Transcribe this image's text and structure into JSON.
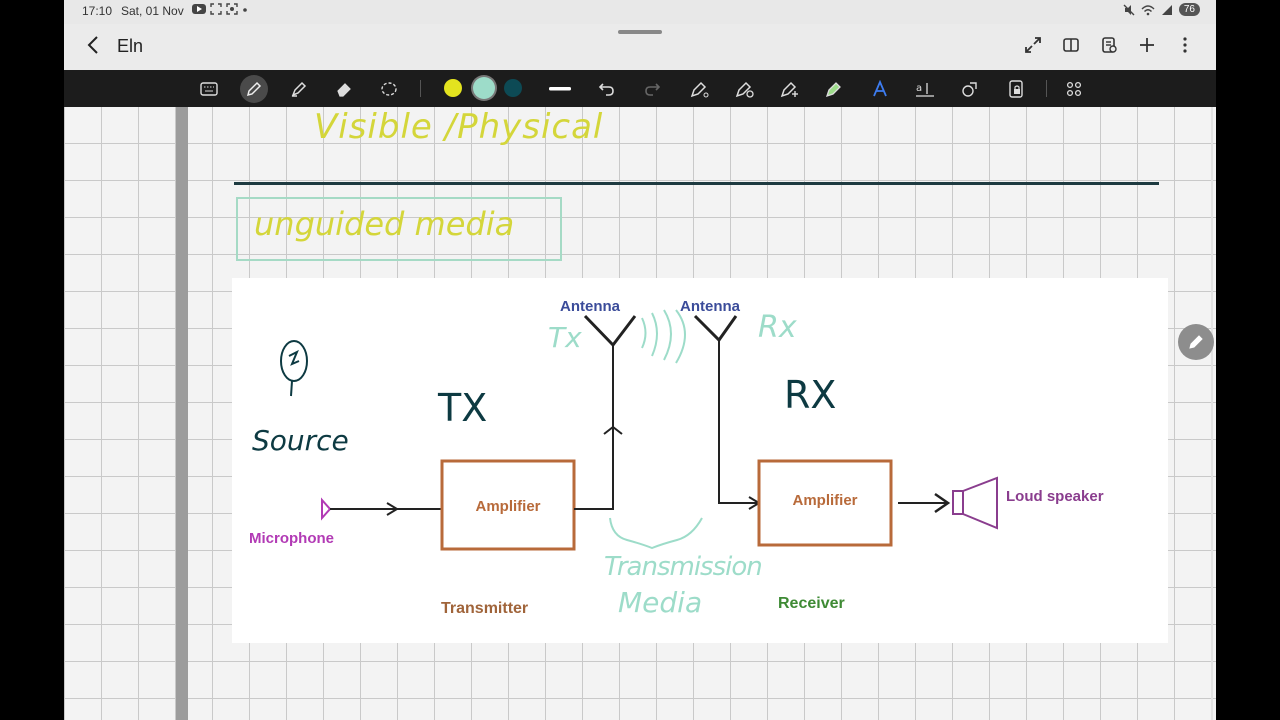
{
  "status": {
    "time": "17:10",
    "date": "Sat, 01 Nov",
    "battery": "76"
  },
  "app": {
    "title": "Eln"
  },
  "toolbar": {
    "colors": {
      "yellow": "#e3e31f",
      "mint": "#9ddcc9",
      "teal": "#0d4a55"
    }
  },
  "notes": {
    "line1": "Visible /Physical",
    "boxed": "unguided media",
    "source_label": "Source",
    "tx_label": "TX",
    "rx_label": "RX",
    "tx_small": "Tx",
    "rx_small": "Rx",
    "transmission_label": "Transmission",
    "media_label": "Media"
  },
  "diagram": {
    "antenna_left": "Antenna",
    "antenna_right": "Antenna",
    "amplifier_tx": "Amplifier",
    "amplifier_rx": "Amplifier",
    "microphone": "Microphone",
    "loud_speaker": "Loud speaker",
    "transmitter": "Transmitter",
    "receiver": "Receiver"
  }
}
